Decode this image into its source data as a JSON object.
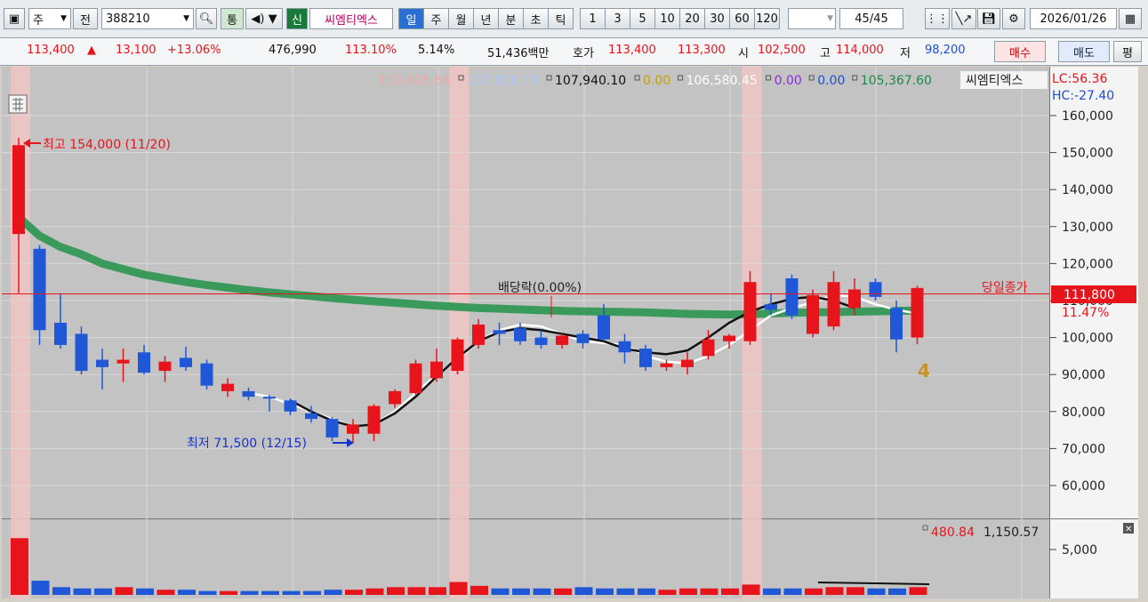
{
  "toolbar": {
    "market_type": "주",
    "prefix": "전",
    "code": "388210",
    "integrated": "통",
    "credit": "신",
    "stock_name": "씨엠티엑스",
    "periods": [
      "일",
      "주",
      "월",
      "년",
      "분",
      "초",
      "틱"
    ],
    "active_period": "일",
    "intervals": [
      "1",
      "3",
      "5",
      "10",
      "20",
      "30",
      "60",
      "120"
    ],
    "count": "45",
    "count_total": "/45",
    "date": "2026/01/26"
  },
  "quote": {
    "price": "113,400",
    "change_arrow": "▲",
    "change": "13,100",
    "change_pct": "+13.06%",
    "volume": "476,990",
    "vol_ratio": "113.10%",
    "turnover": "5.14%",
    "trade_value": "51,436백만",
    "bid_label": "호가",
    "ask_price": "113,400",
    "bid_price": "113,300",
    "open_label": "시",
    "open": "102,500",
    "high_label": "고",
    "high": "114,000",
    "low_label": "저",
    "low": "98,200",
    "buy": "매수",
    "sell": "매도",
    "extra": "평"
  },
  "legend": {
    "ma_values": [
      {
        "text": "110,405.66",
        "color": "#f0a8a8"
      },
      {
        "text": "107,828.74",
        "color": "#a8c4f0"
      },
      {
        "text": "107,940.10",
        "color": "#111111"
      },
      {
        "text": "0.00",
        "color": "#c8a000"
      },
      {
        "text": "106,580.45",
        "color": "#ffffff"
      },
      {
        "text": "0.00",
        "color": "#8a2be2"
      },
      {
        "text": "0.00",
        "color": "#2050d0"
      },
      {
        "text": "105,367.60",
        "color": "#1d8a4a"
      }
    ],
    "name": "씨엠티엑스",
    "lc": "LC:56.36",
    "hc": "HC:-27.40"
  },
  "annotations": {
    "high": "최고 154,000 (11/20)",
    "low": "최저 71,500 (12/15)",
    "dividend": "배당락(0.00%)",
    "close_label": "당일종가",
    "close_price": "111,800",
    "close_pct": "11.47%",
    "marker": "4"
  },
  "volume_legend": {
    "v1": "480.84",
    "v2": "1,150.57",
    "axis": "5,000"
  },
  "colors": {
    "up": "#e8141c",
    "down": "#1f57d6",
    "ma_long": "#3a9a5c",
    "highlight": "#f2c4c4"
  },
  "chart_data": {
    "type": "candlestick",
    "y_ticks": [
      160000,
      150000,
      140000,
      130000,
      120000,
      110000,
      100000,
      90000,
      80000,
      70000,
      60000
    ],
    "ylim": [
      50000,
      165000
    ],
    "close_price": 111800,
    "highlight_candles": [
      0,
      21,
      35
    ],
    "candles": [
      {
        "o": 128000,
        "h": 154000,
        "l": 112000,
        "c": 152000
      },
      {
        "o": 124000,
        "h": 125000,
        "l": 98000,
        "c": 102000
      },
      {
        "o": 104000,
        "h": 112000,
        "l": 97000,
        "c": 98000
      },
      {
        "o": 101000,
        "h": 103000,
        "l": 90000,
        "c": 91000
      },
      {
        "o": 94000,
        "h": 97000,
        "l": 86000,
        "c": 92000
      },
      {
        "o": 93000,
        "h": 97000,
        "l": 88000,
        "c": 94000
      },
      {
        "o": 96000,
        "h": 98000,
        "l": 90000,
        "c": 90500
      },
      {
        "o": 91000,
        "h": 95000,
        "l": 88000,
        "c": 93500
      },
      {
        "o": 94500,
        "h": 97500,
        "l": 91000,
        "c": 92000
      },
      {
        "o": 93000,
        "h": 94000,
        "l": 86000,
        "c": 87000
      },
      {
        "o": 85500,
        "h": 89000,
        "l": 84000,
        "c": 87500
      },
      {
        "o": 85500,
        "h": 86500,
        "l": 83000,
        "c": 84000
      },
      {
        "o": 84000,
        "h": 84500,
        "l": 80000,
        "c": 83500
      },
      {
        "o": 83000,
        "h": 83500,
        "l": 79000,
        "c": 80000
      },
      {
        "o": 79500,
        "h": 81500,
        "l": 77000,
        "c": 78000
      },
      {
        "o": 78000,
        "h": 78500,
        "l": 72000,
        "c": 73000
      },
      {
        "o": 74000,
        "h": 78000,
        "l": 71500,
        "c": 76500
      },
      {
        "o": 74000,
        "h": 82000,
        "l": 72000,
        "c": 81500
      },
      {
        "o": 82000,
        "h": 86000,
        "l": 81000,
        "c": 85500
      },
      {
        "o": 85000,
        "h": 94000,
        "l": 84500,
        "c": 93000
      },
      {
        "o": 89000,
        "h": 97000,
        "l": 88000,
        "c": 93500
      },
      {
        "o": 91000,
        "h": 100000,
        "l": 90000,
        "c": 99500
      },
      {
        "o": 98000,
        "h": 105000,
        "l": 97000,
        "c": 103500
      },
      {
        "o": 102000,
        "h": 104000,
        "l": 98000,
        "c": 101000
      },
      {
        "o": 102500,
        "h": 104000,
        "l": 98000,
        "c": 99000
      },
      {
        "o": 100000,
        "h": 102000,
        "l": 97000,
        "c": 98000
      },
      {
        "o": 98000,
        "h": 101000,
        "l": 97000,
        "c": 100500
      },
      {
        "o": 101000,
        "h": 102000,
        "l": 97000,
        "c": 98500
      },
      {
        "o": 106000,
        "h": 109000,
        "l": 99000,
        "c": 99500
      },
      {
        "o": 99000,
        "h": 101000,
        "l": 93000,
        "c": 96000
      },
      {
        "o": 97000,
        "h": 98000,
        "l": 91000,
        "c": 92000
      },
      {
        "o": 92000,
        "h": 94000,
        "l": 91000,
        "c": 93000
      },
      {
        "o": 92000,
        "h": 96000,
        "l": 90000,
        "c": 94000
      },
      {
        "o": 95000,
        "h": 102000,
        "l": 94000,
        "c": 99500
      },
      {
        "o": 99000,
        "h": 101000,
        "l": 97000,
        "c": 100500
      },
      {
        "o": 99000,
        "h": 118000,
        "l": 98000,
        "c": 115000
      },
      {
        "o": 109000,
        "h": 112000,
        "l": 106000,
        "c": 107500
      },
      {
        "o": 116000,
        "h": 117000,
        "l": 105000,
        "c": 106000
      },
      {
        "o": 101000,
        "h": 113000,
        "l": 100000,
        "c": 111500
      },
      {
        "o": 103000,
        "h": 118000,
        "l": 102000,
        "c": 115000
      },
      {
        "o": 108000,
        "h": 116000,
        "l": 106000,
        "c": 113000
      },
      {
        "o": 115000,
        "h": 116000,
        "l": 110000,
        "c": 111000
      },
      {
        "o": 108000,
        "h": 110000,
        "l": 96000,
        "c": 99500
      },
      {
        "o": 100000,
        "h": 114000,
        "l": 98200,
        "c": 113400
      }
    ],
    "volume": [
      4.4,
      1.1,
      0.6,
      0.5,
      0.5,
      0.6,
      0.5,
      0.4,
      0.4,
      0.3,
      0.3,
      0.3,
      0.3,
      0.3,
      0.3,
      0.4,
      0.4,
      0.5,
      0.6,
      0.6,
      0.6,
      1.0,
      0.7,
      0.5,
      0.5,
      0.5,
      0.5,
      0.6,
      0.5,
      0.5,
      0.5,
      0.4,
      0.5,
      0.5,
      0.5,
      0.8,
      0.5,
      0.5,
      0.5,
      0.6,
      0.6,
      0.5,
      0.5,
      0.6
    ],
    "ma_long": [
      132500,
      127500,
      124500,
      122500,
      120000,
      118500,
      117000,
      116000,
      115000,
      114200,
      113500,
      112800,
      112200,
      111700,
      111200,
      110700,
      110200,
      109800,
      109400,
      109000,
      108600,
      108300,
      108000,
      107800,
      107600,
      107400,
      107200,
      107100,
      107000,
      106900,
      106800,
      106600,
      106400,
      106300,
      106200,
      106300,
      106500,
      106700,
      106800,
      106900,
      107000,
      107100,
      107200,
      107300
    ],
    "ma_white": [
      null,
      null,
      null,
      null,
      null,
      null,
      null,
      null,
      null,
      null,
      null,
      85000,
      84000,
      82000,
      80000,
      78000,
      76000,
      76500,
      80000,
      85000,
      90000,
      94000,
      99000,
      102000,
      103500,
      103000,
      101000,
      99000,
      98500,
      98000,
      95000,
      93500,
      93000,
      95000,
      98000,
      102000,
      106000,
      108000,
      109500,
      111500,
      111000,
      109000,
      107500,
      106500
    ],
    "ma_black": [
      null,
      null,
      null,
      null,
      null,
      null,
      null,
      null,
      null,
      null,
      null,
      null,
      null,
      83000,
      80000,
      77500,
      76000,
      76500,
      79500,
      84000,
      89500,
      94500,
      99000,
      101500,
      102500,
      102000,
      101000,
      100000,
      99000,
      97000,
      96000,
      95500,
      96500,
      100000,
      104000,
      107000,
      109000,
      110500,
      111000,
      110000,
      108000
    ]
  }
}
